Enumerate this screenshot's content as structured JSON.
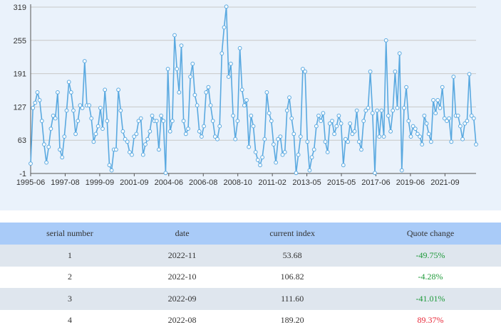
{
  "chart_data": {
    "type": "line",
    "ylim": [
      -1,
      319
    ],
    "yticks": [
      "-1",
      "63",
      "127",
      "191",
      "255",
      "319"
    ],
    "xticks": [
      "1995-06",
      "1997-08",
      "1999-09",
      "2001-09",
      "2004-06",
      "2006-08",
      "2008-10",
      "2011-02",
      "2013-05",
      "2015-05",
      "2017-06",
      "2019-06",
      "2021-09"
    ],
    "grid": true,
    "colors": {
      "line": "#5aa9e0",
      "marker_fill": "#ffffff"
    },
    "series": [
      {
        "values": [
          18,
          125,
          135,
          155,
          140,
          100,
          55,
          20,
          50,
          85,
          110,
          105,
          155,
          45,
          30,
          70,
          120,
          175,
          155,
          120,
          75,
          100,
          130,
          125,
          215,
          130,
          130,
          105,
          60,
          75,
          90,
          125,
          85,
          160,
          100,
          15,
          5,
          45,
          45,
          160,
          120,
          80,
          65,
          60,
          40,
          35,
          70,
          75,
          100,
          105,
          35,
          55,
          65,
          80,
          110,
          100,
          100,
          45,
          110,
          100,
          0,
          200,
          80,
          100,
          265,
          200,
          155,
          245,
          100,
          75,
          85,
          185,
          210,
          150,
          130,
          80,
          70,
          90,
          155,
          165,
          130,
          100,
          70,
          65,
          90,
          230,
          280,
          320,
          185,
          210,
          110,
          65,
          100,
          240,
          160,
          130,
          140,
          50,
          110,
          90,
          40,
          25,
          15,
          30,
          65,
          155,
          115,
          100,
          55,
          20,
          65,
          70,
          35,
          40,
          120,
          145,
          105,
          75,
          0,
          35,
          70,
          200,
          195,
          60,
          5,
          30,
          45,
          90,
          110,
          100,
          115,
          60,
          40,
          95,
          100,
          75,
          90,
          110,
          95,
          15,
          65,
          60,
          95,
          75,
          80,
          120,
          60,
          45,
          100,
          120,
          125,
          195,
          115,
          0,
          120,
          70,
          120,
          70,
          255,
          110,
          80,
          120,
          195,
          125,
          230,
          5,
          125,
          165,
          100,
          70,
          90,
          85,
          75,
          70,
          55,
          110,
          95,
          75,
          60,
          140,
          115,
          140,
          125,
          165,
          105,
          100,
          105,
          60,
          185,
          110,
          110,
          90,
          65,
          95,
          100,
          190,
          110,
          105,
          55
        ]
      }
    ]
  },
  "table": {
    "headers": [
      "serial number",
      "date",
      "current index",
      "Quote change"
    ],
    "rows": [
      {
        "serial": "1",
        "date": "2022-11",
        "index": "53.68",
        "change": "-49.75%",
        "direction": "down"
      },
      {
        "serial": "2",
        "date": "2022-10",
        "index": "106.82",
        "change": "-4.28%",
        "direction": "down"
      },
      {
        "serial": "3",
        "date": "2022-09",
        "index": "111.60",
        "change": "-41.01%",
        "direction": "down"
      },
      {
        "serial": "4",
        "date": "2022-08",
        "index": "189.20",
        "change": "89.37%",
        "direction": "up"
      }
    ]
  }
}
